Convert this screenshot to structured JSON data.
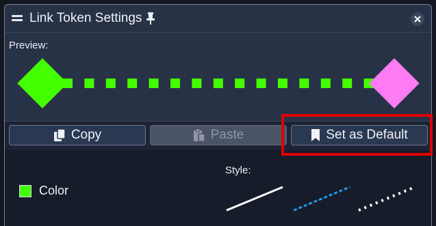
{
  "window": {
    "title": "Link Token Settings",
    "icons": {
      "drag": "drag-handle-icon",
      "pin": "pin-icon",
      "close": "close-icon"
    }
  },
  "preview": {
    "label": "Preview:",
    "start_color": "#44ff00",
    "end_color": "#ff7bf3",
    "line_color": "#44ff00",
    "line_style": "dotted"
  },
  "buttons": {
    "copy": {
      "label": "Copy",
      "icon": "copy-icon",
      "enabled": true
    },
    "paste": {
      "label": "Paste",
      "icon": "paste-icon",
      "enabled": false
    },
    "set_default": {
      "label": "Set as Default",
      "icon": "bookmark-icon",
      "enabled": true
    }
  },
  "properties": {
    "color_label": "Color",
    "color_value": "#44ff00",
    "style_label": "Style:",
    "styles": [
      {
        "name": "solid",
        "color": "#ffffff"
      },
      {
        "name": "dashed",
        "color": "#1e9be6"
      },
      {
        "name": "dotted",
        "color": "#ffffff"
      }
    ]
  },
  "highlight_color": "#e00000"
}
